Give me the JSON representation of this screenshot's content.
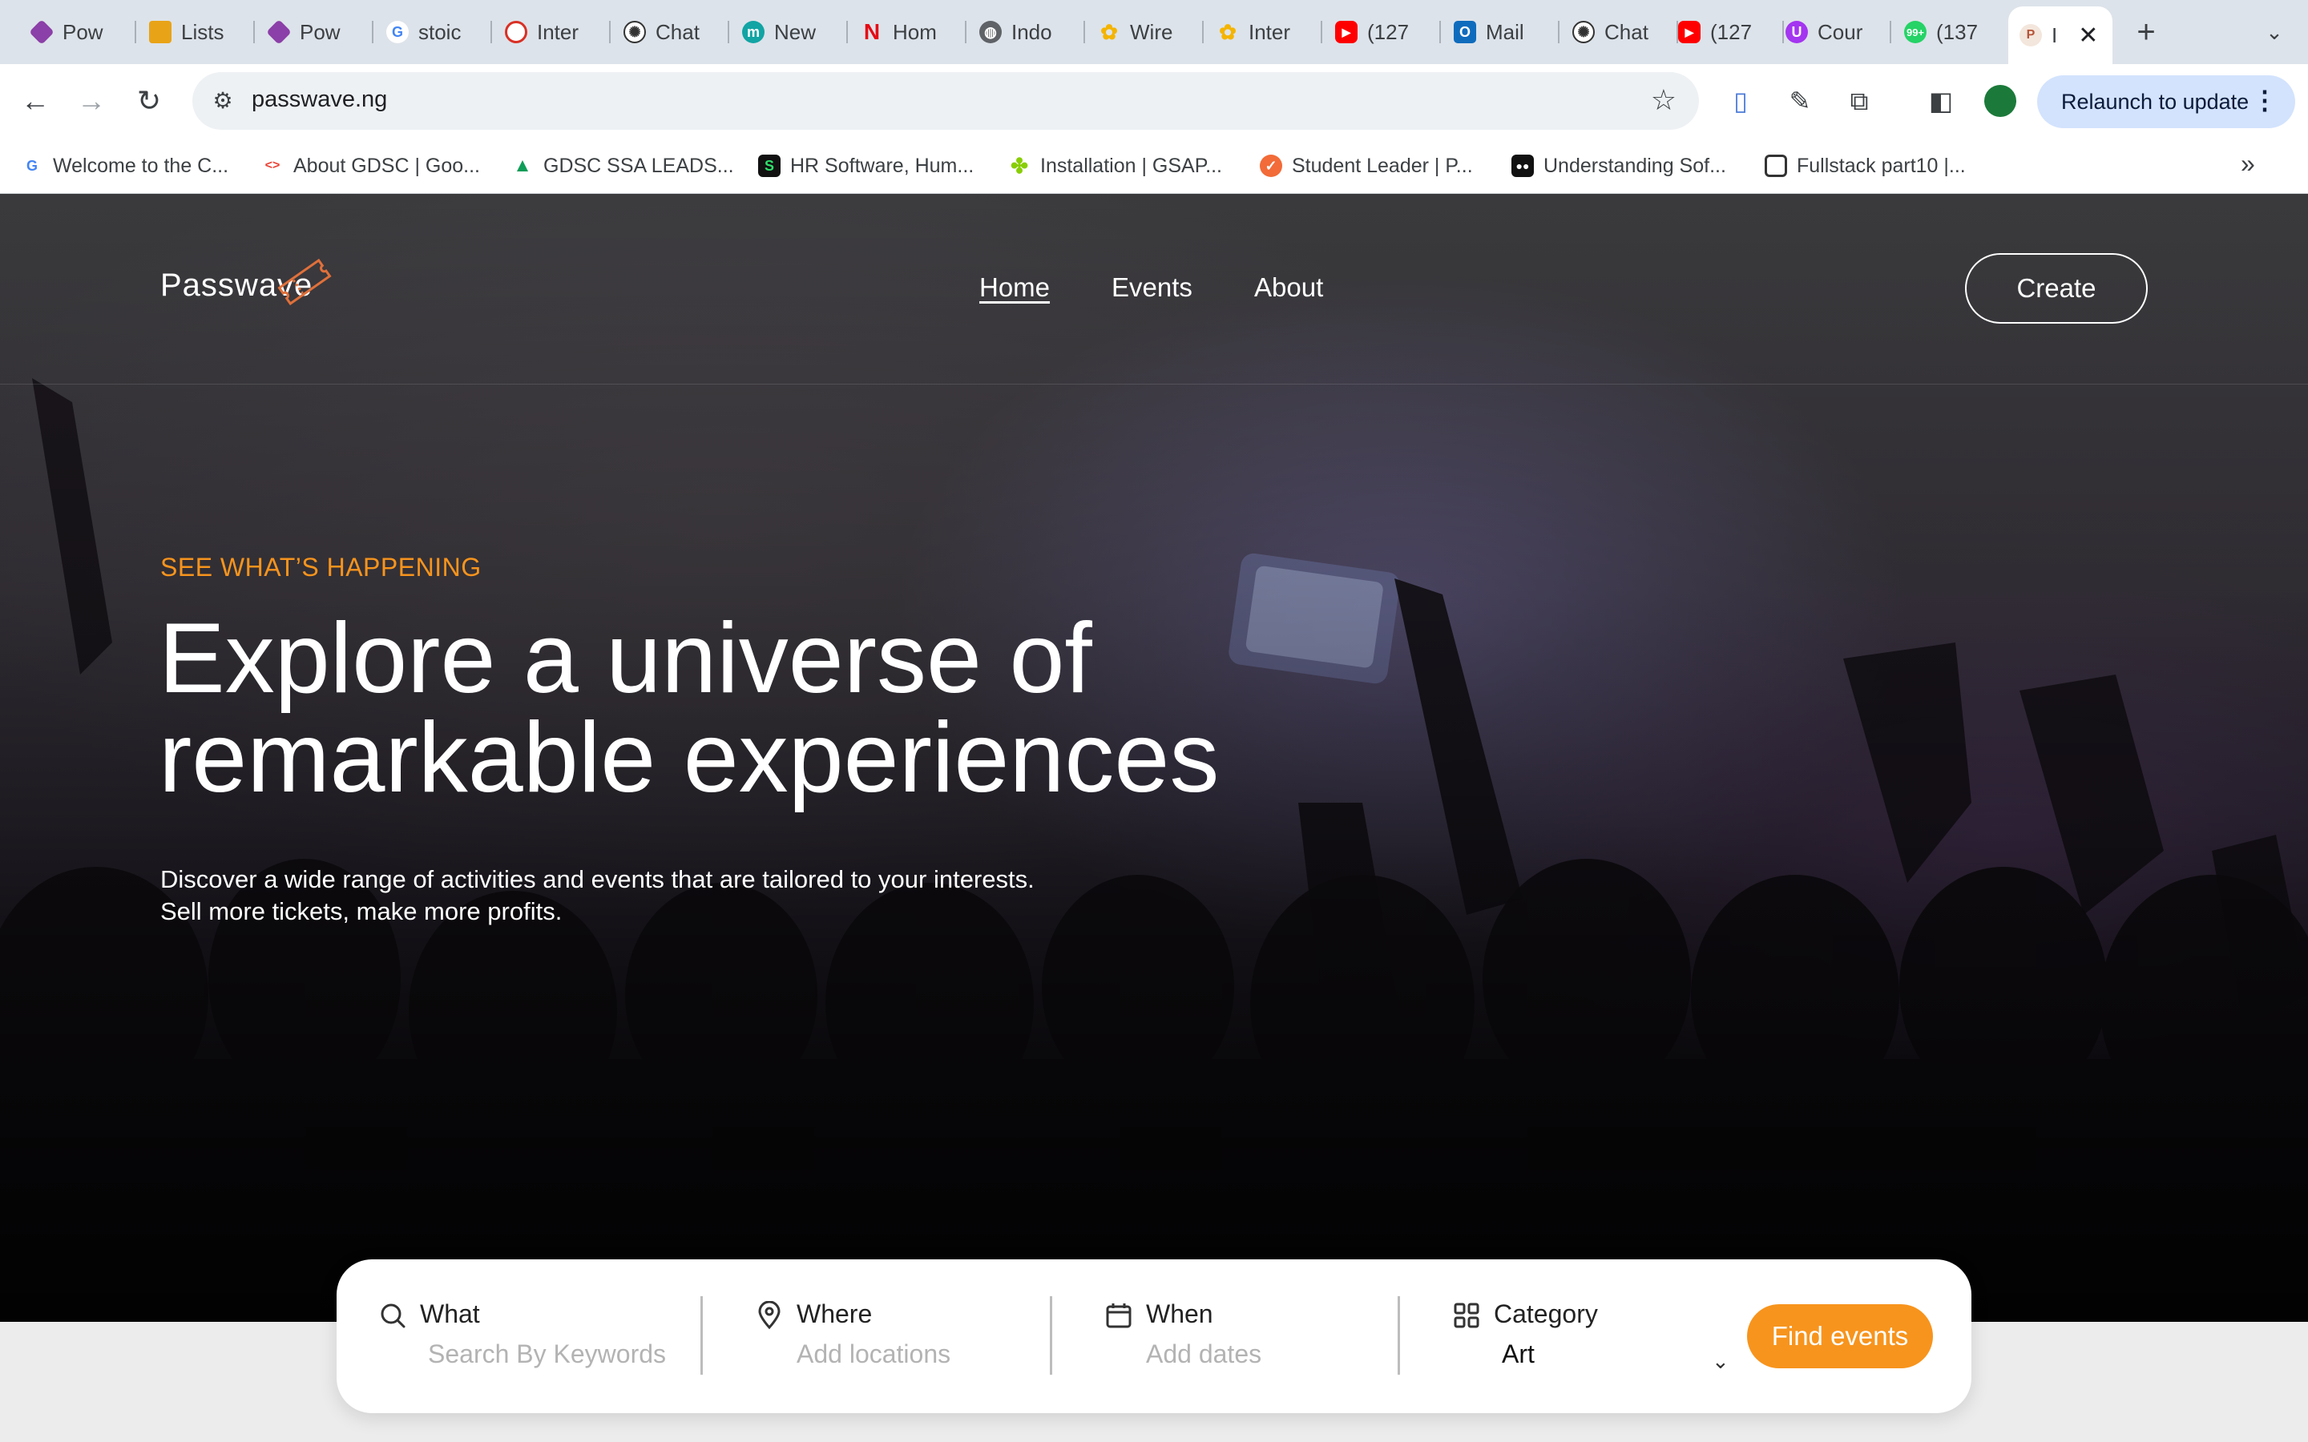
{
  "browser": {
    "tabs": [
      {
        "title": "Pow",
        "icon": "powerapps-icon",
        "color": "#8b3fa8"
      },
      {
        "title": "Lists",
        "icon": "lists-icon",
        "color": "#e8a317"
      },
      {
        "title": "Pow",
        "icon": "powerapps-icon",
        "color": "#8b3fa8"
      },
      {
        "title": "stoic",
        "icon": "google-icon",
        "color": "#4285f4"
      },
      {
        "title": "Inter",
        "icon": "dashboard-icon",
        "color": "#d93025"
      },
      {
        "title": "Chat",
        "icon": "openai-icon",
        "color": "#333333"
      },
      {
        "title": "New",
        "icon": "m-icon",
        "color": "#12a4a4"
      },
      {
        "title": "Hom",
        "icon": "netflix-icon",
        "color": "#e50914"
      },
      {
        "title": "Indo",
        "icon": "globe-icon",
        "color": "#5f6368"
      },
      {
        "title": "Wire",
        "icon": "figma-icon",
        "color": "#f4b400"
      },
      {
        "title": "Inter",
        "icon": "figma-icon",
        "color": "#f4b400"
      },
      {
        "title": "(127",
        "icon": "youtube-icon",
        "color": "#ff0000"
      },
      {
        "title": "Mail",
        "icon": "outlook-icon",
        "color": "#0f6cbd"
      },
      {
        "title": "Chat",
        "icon": "openai-icon",
        "color": "#333333"
      },
      {
        "title": "(127",
        "icon": "youtube-icon",
        "color": "#ff0000"
      },
      {
        "title": "Cour",
        "icon": "udemy-icon",
        "color": "#a435f0"
      },
      {
        "title": "(137",
        "icon": "whatsapp-icon",
        "color": "#25d366"
      },
      {
        "title": "I",
        "icon": "passwave-icon",
        "color": "#f3e6dc"
      }
    ],
    "url": "passwave.ng",
    "relaunch_label": "Relaunch to update",
    "bookmarks": [
      {
        "title": "Welcome to the C...",
        "icon": "google-icon",
        "color": "#ffffff"
      },
      {
        "title": "About GDSC | Goo...",
        "icon": "gdsc-icon",
        "color": "#ffffff"
      },
      {
        "title": "GDSC SSA LEADS...",
        "icon": "drive-icon",
        "color": "#ffffff"
      },
      {
        "title": "HR Software, Hum...",
        "icon": "s-icon",
        "color": "#111111"
      },
      {
        "title": "Installation | GSAP...",
        "icon": "gsap-icon",
        "color": "#88ce02"
      },
      {
        "title": "Student Leader | P...",
        "icon": "p-icon",
        "color": "#f26b38"
      },
      {
        "title": "Understanding Sof...",
        "icon": "medium-icon",
        "color": "#111111"
      },
      {
        "title": "Fullstack part10 |...",
        "icon": "page-icon",
        "color": "#ffffff"
      }
    ]
  },
  "site": {
    "logo": "Passwave",
    "nav": [
      "Home",
      "Events",
      "About"
    ],
    "create_label": "Create",
    "eyebrow": "SEE WHAT’S HAPPENING",
    "headline_line1": "Explore a universe of",
    "headline_line2": "remarkable experiences",
    "sub_line1": "Discover a wide range of activities and events that are tailored to your interests.",
    "sub_line2": "Sell more tickets, make more profits.",
    "accent_color": "#f7941d",
    "search": {
      "what_label": "What",
      "what_placeholder": "Search By Keywords",
      "where_label": "Where",
      "where_placeholder": "Add locations",
      "when_label": "When",
      "when_placeholder": "Add dates",
      "category_label": "Category",
      "category_value": "Art",
      "find_label": "Find events"
    }
  }
}
